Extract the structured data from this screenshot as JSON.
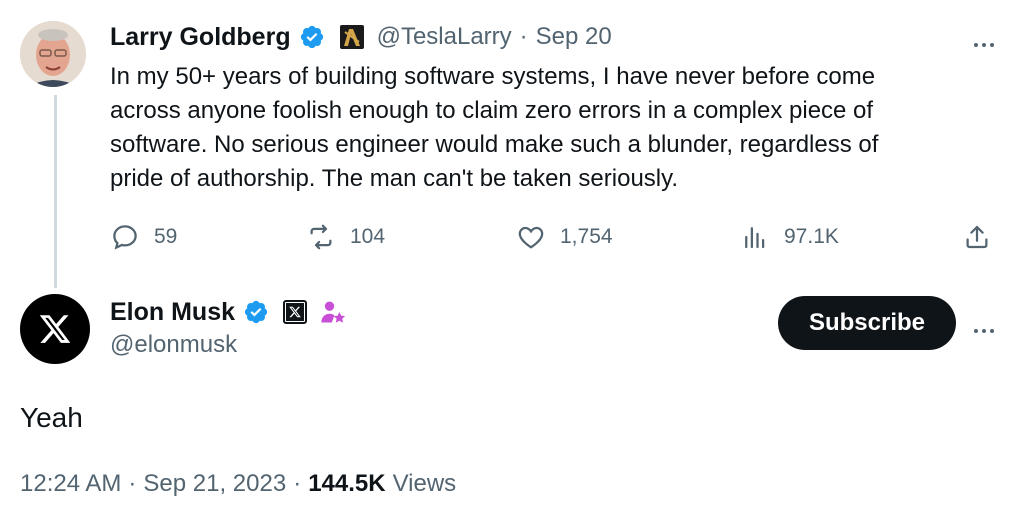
{
  "colors": {
    "text": "#0f1419",
    "muted": "#536471",
    "verified": "#1d9bf0",
    "thread_line": "#cfd9de",
    "subscribe_bg": "#0f1419"
  },
  "reply_to_tweet": {
    "author_name": "Larry Goldberg",
    "handle": "@TeslaLarry",
    "separator": "·",
    "date": "Sep 20",
    "lines": [
      "In my 50+ years of building software systems, I have never before come",
      "across anyone foolish enough to claim zero errors in a complex piece of",
      "software.  No serious engineer would make such a blunder, regardless of",
      "pride of authorship. The man can't be taken seriously."
    ],
    "metrics": {
      "replies": "59",
      "retweets": "104",
      "likes": "1,754",
      "views": "97.1K"
    },
    "icons": [
      "verified-icon",
      "affiliate-badge-icon",
      "more-icon",
      "reply-icon",
      "retweet-icon",
      "like-icon",
      "views-icon",
      "share-icon"
    ]
  },
  "main_tweet": {
    "author_name": "Elon Musk",
    "handle": "@elonmusk",
    "subscribe_label": "Subscribe",
    "text": "Yeah",
    "time": "12:24 AM",
    "sep1": "·",
    "date": "Sep 21, 2023",
    "sep2": "·",
    "views_count": "144.5K",
    "views_label": "Views",
    "icons": [
      "x-logo-icon",
      "verified-icon",
      "x-badge-icon",
      "person-star-icon",
      "more-icon"
    ]
  }
}
